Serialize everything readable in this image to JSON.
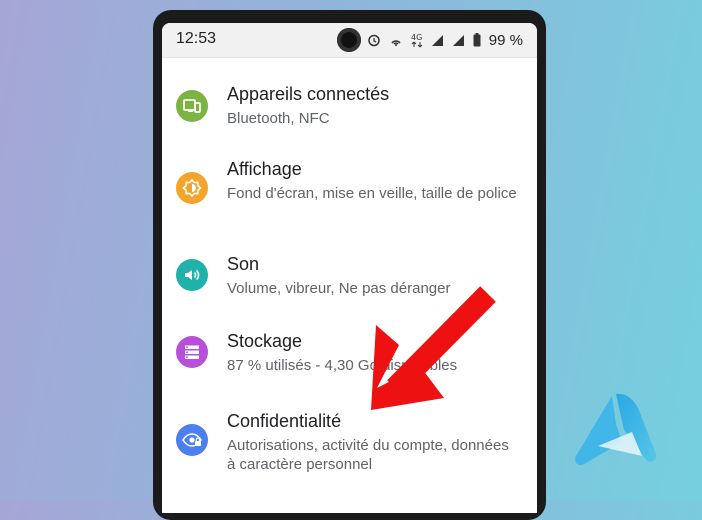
{
  "status_bar": {
    "time": "12:53",
    "battery": "99 %",
    "icons": [
      "alarm-icon",
      "hotspot-icon",
      "network-4g-icon",
      "signal-icon",
      "signal-icon",
      "battery-icon"
    ]
  },
  "settings": {
    "items": [
      {
        "icon": "devices-icon",
        "color": "#7cb342",
        "title": "Appareils connectés",
        "subtitle": "Bluetooth, NFC"
      },
      {
        "icon": "brightness-icon",
        "color": "#f4a42a",
        "title": "Affichage",
        "subtitle": "Fond d'écran, mise en veille, taille de police"
      },
      {
        "icon": "sound-icon",
        "color": "#20b2aa",
        "title": "Son",
        "subtitle": "Volume, vibreur, Ne pas déranger"
      },
      {
        "icon": "storage-icon",
        "color": "#b84fd9",
        "title": "Stockage",
        "subtitle": "87 % utilisés - 4,30 Go disponibles"
      },
      {
        "icon": "privacy-icon",
        "color": "#4c7ff0",
        "title": "Confidentialité",
        "subtitle": "Autorisations, activité du compte, données à caractère personnel"
      }
    ]
  },
  "annotation": {
    "arrow_color": "#ee1111"
  },
  "colors": {
    "title": "#202124",
    "subtitle": "#5f6368"
  }
}
